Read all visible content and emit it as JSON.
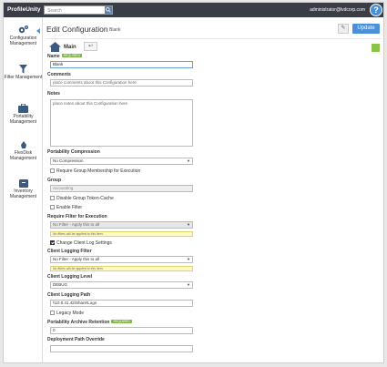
{
  "topbar": {
    "brand": "ProfileUnity",
    "search_placeholder": "Search",
    "user": "administrator@lvdcorp.com",
    "help_label": "?"
  },
  "sidebar": {
    "items": [
      {
        "label": "Configuration Management",
        "icon": "gears-icon",
        "active": true
      },
      {
        "label": "Filter Management",
        "icon": "filter-icon"
      },
      {
        "label": "Portability Management",
        "icon": "briefcase-icon"
      },
      {
        "label": "FlexDisk Management",
        "icon": "flexdisk-icon"
      },
      {
        "label": "Inventory Management",
        "icon": "inventory-icon"
      }
    ]
  },
  "header": {
    "title": "Edit Configuration",
    "subtitle": "Blank",
    "pin_label": "✎",
    "update_label": "Update"
  },
  "tabs": {
    "main_label": "Main",
    "back_label": "↩"
  },
  "form": {
    "name_label": "Name",
    "required_badge": "REQUIRED",
    "name_value": "Blank",
    "comments_label": "Comments",
    "comments_placeholder": "place comments about this Configuration here",
    "notes_label": "Notes",
    "notes_placeholder": "place notes about this Configuration here",
    "portability_compression_label": "Portability Compression",
    "portability_compression_value": "No Compression",
    "require_group_membership_label": "Require Group Membership for Execution",
    "group_label": "Group",
    "group_value": "Accounting",
    "disable_group_token_label": "Disable Group Token-Cache",
    "enable_filter_label": "Enable Filter",
    "require_filter_label": "Require Filter for Execution",
    "require_filter_value": "No Filter - Apply this to all",
    "no_filter_warning": "No filters will be applied to this item.",
    "change_client_log_label": "Change Client Log Settings",
    "client_logging_filter_label": "Client Logging Filter",
    "client_logging_filter_value": "No Filter - Apply this to all",
    "client_logging_level_label": "Client Logging Level",
    "client_logging_level_value": "DEBUG",
    "client_logging_path_label": "Client Logging Path",
    "client_logging_path_value": "\\\\10.0.41.42\\Share\\Logs",
    "legacy_mode_label": "Legacy Mode",
    "portability_archive_label": "Portability Archive Retention",
    "portability_archive_value": "0",
    "deployment_path_label": "Deployment Path Override",
    "deployment_path_value": ""
  },
  "colors": {
    "topbar": "#3a3d45",
    "accent": "#4a90d9",
    "required_badge": "#7cb342",
    "warning_bg": "#fff9c4"
  }
}
